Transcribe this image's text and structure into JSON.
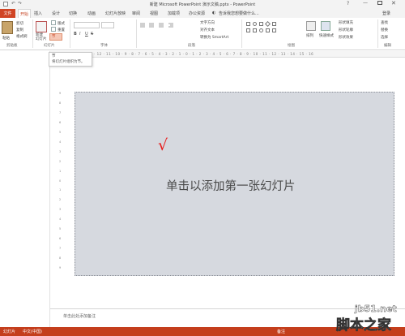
{
  "window": {
    "title": "新建 Microsoft PowerPoint 演示文稿.pptx - PowerPoint",
    "help": "?",
    "minimize": "—",
    "close": "✕"
  },
  "qat": {
    "undo": "↶",
    "redo": "↷"
  },
  "tabs": {
    "file": "文件",
    "home": "开始",
    "items": [
      "插入",
      "设计",
      "切换",
      "动画",
      "幻灯片放映",
      "审阅",
      "视图",
      "加载项",
      "办公资源"
    ],
    "tell_me": "告诉我您想要做什么...",
    "login": "登录"
  },
  "ribbon": {
    "paste": "粘贴",
    "clipboard_items": [
      "剪切",
      "复制",
      "格式刷"
    ],
    "new_slide": "新建\n幻灯片",
    "layout": "版式",
    "reset": "重置",
    "section": "节",
    "text_direction": "文字方向",
    "align_text": "对齐文本",
    "to_smartart": "转换为 SmartArt",
    "arrange": "排列",
    "quick_styles": "快速样式",
    "shape_fill": "形状填充",
    "shape_outline": "形状轮廓",
    "shape_effects": "形状效果",
    "find": "查找",
    "replace": "替换",
    "select": "选择",
    "groups": {
      "clipboard": "剪贴板",
      "slides": "幻灯片",
      "font": "字体",
      "paragraph": "段落",
      "drawing": "绘图",
      "editing": "编辑"
    },
    "font_buttons": {
      "bold": "B",
      "italic": "I",
      "underline": "U",
      "strike": "S"
    }
  },
  "ruler": {
    "labels": "16 · 15 · 14 · 13 · 12 · 11 · 10 · 9 · 8 · 7 · 6 · 5 · 4 · 3 · 2 · 1 · 0 · 1 · 2 · 3 · 4 · 5 · 6 · 7 · 8 · 9 · 10 · 11 · 12 · 13 · 14 · 15 · 16"
  },
  "vruler": {
    "labels": [
      "9",
      "8",
      "7",
      "6",
      "5",
      "4",
      "3",
      "2",
      "1",
      "0",
      "1",
      "2",
      "3",
      "4",
      "5",
      "6",
      "7",
      "8",
      "9"
    ]
  },
  "tooltip": {
    "title": "节",
    "description": "将幻灯片组织为节。"
  },
  "slide": {
    "placeholder": "单击以添加第一张幻灯片",
    "checkmark": "√"
  },
  "notes": {
    "placeholder": "单击此处添加备注"
  },
  "status": {
    "slide": "幻灯片",
    "language": "中文(中国)",
    "notes": "备注"
  },
  "watermark": {
    "url": "jb51.net",
    "text": "脚本之家"
  },
  "colors": {
    "accent": "#c43e1c",
    "slide_bg": "#d6d9df",
    "check": "#e81b1b"
  }
}
